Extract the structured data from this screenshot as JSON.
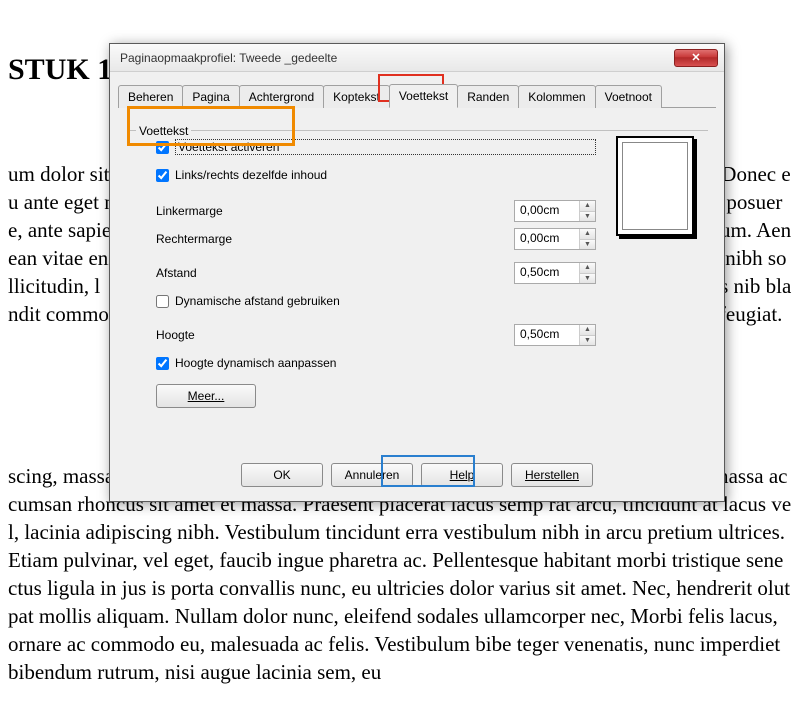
{
  "bg": {
    "heading": "STUK 1",
    "para1": "um dolor sit amet, consectetur adipiscing elit. Nulla in dignissim augue. Nulla enim. Donec eu ante eget nulla faucibus gravida dapibus a lorem. In eu c rat volutpat, est accumsan posuere, ante sapien pharetra magna. Fusce et sap is. Nulla viverra dapibus urna ac elementum. Aenean vitae enim ac, varius c  eros accumsan, cras elit. Suspendisse adipiscing libero at nibh sollicitudin, l  aliquam, molestie sed metus, fermentum dictum ac, ultricies in. Phasellus nib blandit commodo. Nullam sit amet ultrices, integer porta, nec sodales eget r amet dolor feugiat.",
    "para2": "scing, massa eget tincidunt consectetur, mollis adipiscing, sollicitudin nunc e sus at massa accumsan rhoncus sit amet et massa. Praesent placerat lacus semp rat arcu, tincidunt at lacus vel, lacinia adipiscing nibh. Vestibulum tincidunt erra vestibulum nibh in arcu pretium ultrices. Etiam pulvinar, vel eget, faucib ingue pharetra ac. Pellentesque habitant morbi tristique senectus ligula in jus is porta convallis nunc, eu ultricies dolor varius sit amet. Nec, hendrerit olutpat mollis aliquam. Nullam dolor nunc, eleifend sodales ullamcorper nec, Morbi felis lacus, ornare ac commodo eu, malesuada ac felis. Vestibulum bibe teger venenatis, nunc imperdiet bibendum rutrum, nisi augue lacinia sem, eu"
  },
  "dialog": {
    "title": "Paginaopmaakprofiel: Tweede _gedeelte",
    "tabs": [
      "Beheren",
      "Pagina",
      "Achtergrond",
      "Koptekst",
      "Voettekst",
      "Randen",
      "Kolommen",
      "Voetnoot"
    ],
    "group": "Voettekst",
    "activate": "Voettekst activeren",
    "samelr": "Links/rechts dezelfde inhoud",
    "leftmargin_lbl": "Linkermarge",
    "leftmargin_val": "0,00cm",
    "rightmargin_lbl": "Rechtermarge",
    "rightmargin_val": "0,00cm",
    "spacing_lbl": "Afstand",
    "spacing_val": "0,50cm",
    "dynspacing": "Dynamische afstand gebruiken",
    "height_lbl": "Hoogte",
    "height_val": "0,50cm",
    "autoheight": "Hoogte dynamisch aanpassen",
    "more": "Meer...",
    "ok": "OK",
    "cancel": "Annuleren",
    "help": "Help",
    "reset": "Herstellen"
  }
}
